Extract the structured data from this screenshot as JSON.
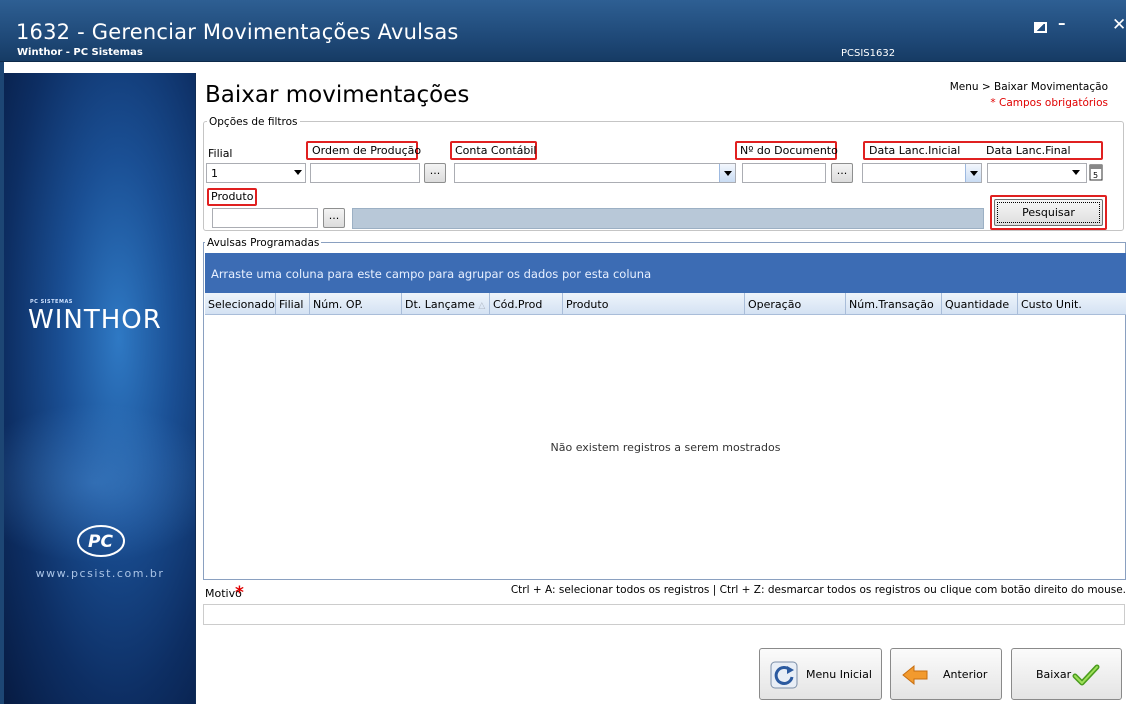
{
  "window": {
    "title": "1632 - Gerenciar Movimentações Avulsas",
    "subtitle": "Winthor - PC Sistemas",
    "code": "PCSIS1632"
  },
  "sidebar": {
    "brand_small": "PC SISTEMAS",
    "brand": "WINTHOR",
    "site": "www.pcsist.com.br"
  },
  "page": {
    "title": "Baixar movimentações",
    "breadcrumb": "Menu > Baixar Movimentação",
    "required_note": "* Campos obrigatórios"
  },
  "filters": {
    "legend": "Opções de filtros",
    "filial_label": "Filial",
    "filial_value": "1",
    "ordem_label": "Ordem de Produção",
    "conta_label": "Conta Contábil",
    "documento_label": "Nº do Documento",
    "data_inicial_label": "Data Lanc.Inicial",
    "data_final_label": "Data Lanc.Final",
    "produto_label": "Produto",
    "ellipsis": "...",
    "search_button": "Pesquisar"
  },
  "grid": {
    "legend": "Avulsas Programadas",
    "group_hint": "Arraste uma coluna para este campo para agrupar os dados por esta coluna",
    "columns": [
      "Selecionado",
      "Filial",
      "Núm. OP.",
      "Dt. Lançame",
      "Cód.Prod",
      "Produto",
      "Operação",
      "Núm.Transação",
      "Quantidade",
      "Custo Unit."
    ],
    "empty_message": "Não existem registros a serem mostrados"
  },
  "footer": {
    "shortcuts": "Ctrl + A: selecionar todos os registros | Ctrl + Z: desmarcar todos os registros ou clique com botão direito do mouse.",
    "motivo_label": "Motivo",
    "motivo_required": "*",
    "menu_inicial": "Menu Inicial",
    "anterior": "Anterior",
    "baixar": "Baixar"
  },
  "colors": {
    "title_bar": "#1d4674",
    "highlight": "#e02020",
    "group_bar": "#3c6cb4",
    "required": "#e00000"
  }
}
